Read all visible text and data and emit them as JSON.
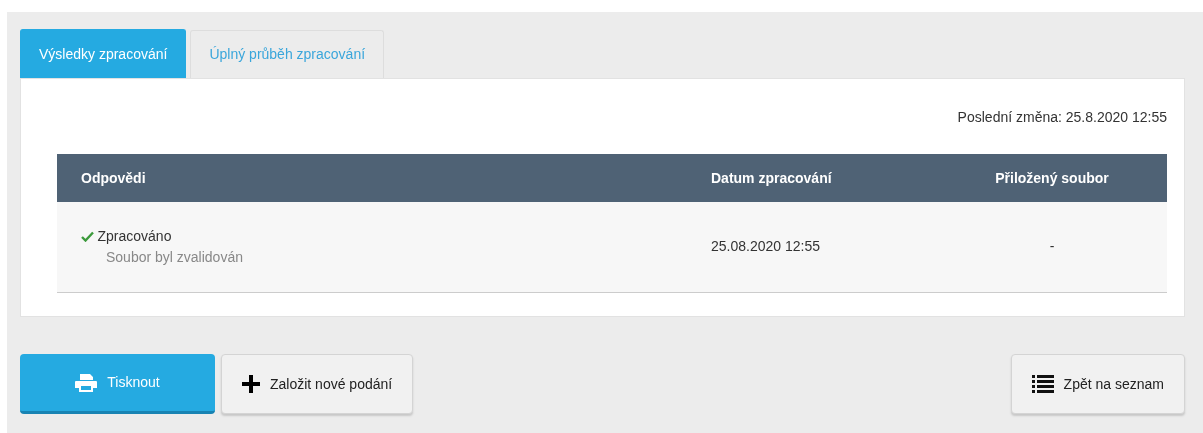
{
  "tabs": [
    {
      "label": "Výsledky zpracování",
      "selected": true
    },
    {
      "label": "Úplný průběh zpracování",
      "selected": false
    }
  ],
  "last_change": "Poslední změna: 25.8.2020 12:55",
  "table": {
    "columns": [
      "Odpovědi",
      "Datum zpracování",
      "Přiložený soubor"
    ],
    "rows": [
      {
        "status": "Zpracováno",
        "ok": true,
        "detail": "Soubor byl zvalidován",
        "date": "25.08.2020 12:55",
        "file": "-"
      }
    ]
  },
  "buttons": [
    {
      "label": "Tisknout",
      "kind": "print"
    },
    {
      "label": "Založit nové podání",
      "kind": "add"
    },
    {
      "label": "Zpět na seznam",
      "kind": "list"
    }
  ]
}
